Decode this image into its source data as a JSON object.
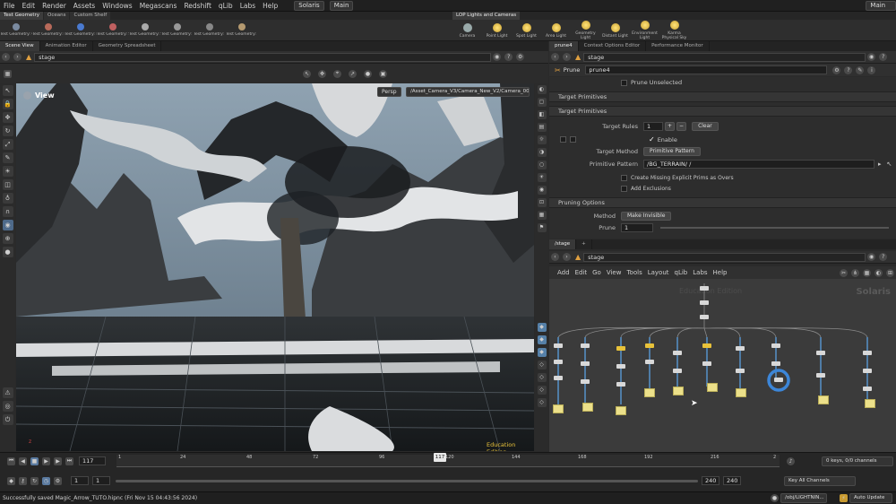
{
  "menubar": {
    "items": [
      "File",
      "Edit",
      "Render",
      "Assets",
      "Windows",
      "Megascans",
      "Redshift",
      "qLib",
      "Labs",
      "Help"
    ],
    "desktop": "Solaris",
    "context": "Main",
    "right_build": "Main"
  },
  "shelf": {
    "tabs": [
      "Test Geometry",
      "Oceans",
      "Custom Shelf"
    ],
    "tools": [
      "Test Geometry: C...",
      "Test Geometry: R...",
      "Test Geometry: R...",
      "Test Geometry: S...",
      "Test Geometry: S...",
      "Test Geometry: T...",
      "Test Geometry: T...",
      "Test Geometry: T..."
    ],
    "tab2": "LOP Lights and Cameras",
    "tools2": [
      "Camera",
      "Point Light",
      "Spot Light",
      "Area Light",
      "Geometry Light",
      "Distant Light",
      "Environment Light",
      "Karma Physical Sky"
    ]
  },
  "viewer": {
    "tabs": [
      "Scene View",
      "Animation Editor",
      "Geometry Spreadsheet"
    ],
    "path": "stage",
    "title": "View",
    "persp": "Persp",
    "camera": "/Asset_Camera_V3/Camera_New_V2/Camera_005",
    "watermark": "Education Edition",
    "axis": "z"
  },
  "params_pane": {
    "tabs": [
      "prune4",
      "Context Options Editor",
      "Performance Monitor"
    ],
    "path": "stage",
    "node_type": "Prune",
    "node_name": "prune4",
    "prune_unselected": "Prune Unselected",
    "sections": [
      "Target Primitives",
      "Target Primitives",
      "Pruning Options"
    ],
    "target_rules_label": "Target Rules",
    "target_rules_value": "1",
    "clear": "Clear",
    "enable": "Enable",
    "target_method_label": "Target Method",
    "target_method_value": "Primitive Pattern",
    "primitive_pattern_label": "Primitive Pattern",
    "primitive_pattern_value": "/BG_TERRAIN/ /",
    "create_missing": "Create Missing Explicit Prims as Overs",
    "add_exclusions": "Add Exclusions",
    "method_label": "Method",
    "method_value": "Make Invisible",
    "prune_label": "Prune",
    "prune_value": "1"
  },
  "network_pane": {
    "tab": "/stage",
    "path": "stage",
    "menu": [
      "Add",
      "Edit",
      "Go",
      "View",
      "Tools",
      "Layout",
      "qLib",
      "Labs",
      "Help"
    ],
    "label": "Solaris",
    "edu": "Education Edition"
  },
  "timeline": {
    "current_frame": "117",
    "ticks": [
      "1",
      "24",
      "48",
      "72",
      "96",
      "120",
      "144",
      "168",
      "192",
      "216",
      "2"
    ],
    "start": "1",
    "start2": "1",
    "end": "240",
    "end2": "240",
    "keys_info": "0 keys, 0/0 channels",
    "key_all": "Key All Channels"
  },
  "status": {
    "message": "Successfully saved Magic_Arrow_TUTO.hipnc (Fri Nov 15 04:43:56 2024)",
    "path": "/obj/LIGHTNIN...",
    "auto_update": "Auto Update"
  }
}
